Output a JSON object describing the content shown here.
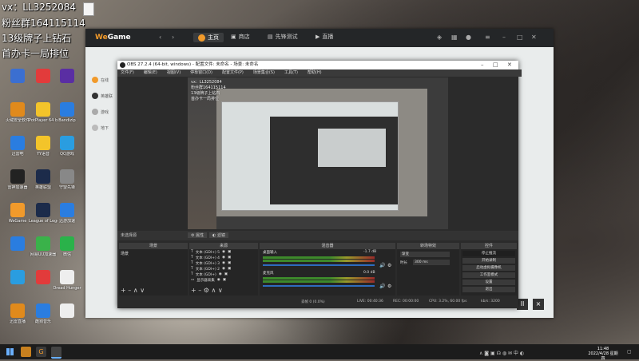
{
  "overlay": {
    "line1": "vx：LL3252084",
    "line2": "粉丝群164115114",
    "line3": "13级牌子上钻石",
    "line4": "首办卡一局排位"
  },
  "desktop_icons": [
    {
      "label": "",
      "color": "#3b6fd1"
    },
    {
      "label": "",
      "color": "#e23b3b"
    },
    {
      "label": "",
      "color": "#5a2ea3"
    },
    {
      "label": "火绒安全软件",
      "color": "#e08a1c"
    },
    {
      "label": "PotPlayer 64 bit",
      "color": "#f3c42a"
    },
    {
      "label": "Bandizip",
      "color": "#2a7de0"
    },
    {
      "label": "迅雷吧",
      "color": "#2a7de0"
    },
    {
      "label": "YY语音",
      "color": "#f3c42a"
    },
    {
      "label": "QQ游戏",
      "color": "#2a9de0"
    },
    {
      "label": "雷神加速器",
      "color": "#222"
    },
    {
      "label": "英雄联盟",
      "color": "#1c2b4a"
    },
    {
      "label": "守望先锋",
      "color": "#888"
    },
    {
      "label": "WeGame",
      "color": "#f19a2b"
    },
    {
      "label": "League of Legends",
      "color": "#1c2b4a"
    },
    {
      "label": "迅游加速",
      "color": "#2a7de0"
    },
    {
      "label": "",
      "color": "#2a7de0"
    },
    {
      "label": "网易UU加速器",
      "color": "#3ab24a"
    },
    {
      "label": "微信",
      "color": "#2ab24a"
    },
    {
      "label": "",
      "color": "#2a9de0"
    },
    {
      "label": "",
      "color": "#e23b3b"
    },
    {
      "label": "Dread Hunger",
      "color": "#eee"
    },
    {
      "label": "迅雷直播",
      "color": "#e08a1c"
    },
    {
      "label": "酷狗音乐",
      "color": "#2a7de0"
    },
    {
      "label": "",
      "color": "#eee"
    }
  ],
  "wegame": {
    "logo_we": "We",
    "logo_game": "Game",
    "nav": [
      {
        "label": "主页",
        "icon": "home-icon"
      },
      {
        "label": "商店",
        "icon": "store-icon"
      },
      {
        "label": "先锋测试",
        "icon": "test-icon"
      },
      {
        "label": "直播",
        "icon": "live-icon"
      }
    ],
    "side": [
      "在线",
      "英雄联",
      "游戏",
      "地下"
    ],
    "bottom": [
      "II",
      "×"
    ]
  },
  "obs": {
    "title": "OBS 27.2.4 (64-bit, windows) - 配置文件: 未命名 - 场景: 未命名",
    "menu": [
      "文件(F)",
      "编辑(E)",
      "视图(V)",
      "停靠窗口(D)",
      "配置文件(P)",
      "场景集合(S)",
      "工具(T)",
      "帮助(H)"
    ],
    "preview_overlay": [
      "vx：LL3252084",
      "粉丝群164115114",
      "13级牌子上钻石",
      "首办卡一局排位"
    ],
    "no_source": "未选择源",
    "props_btn": "属性",
    "filters_btn": "滤镜",
    "docks": {
      "scenes": "场景",
      "sources": "来源",
      "mixer": "混音器",
      "transitions": "转场特效",
      "controls": "控件"
    },
    "scene_item": "场景",
    "sources": [
      "文本 (GDI+) 5",
      "文本 (GDI+) 4",
      "文本 (GDI+) 3",
      "文本 (GDI+) 2",
      "文本 (GDI+)",
      "显示器采集"
    ],
    "mixer": [
      {
        "name": "桌面输入",
        "db": "-1.7 dB"
      },
      {
        "name": "麦克风",
        "db": "0.0 dB"
      }
    ],
    "transition": {
      "type": "渐变",
      "duration_label": "时长",
      "duration": "300 ms"
    },
    "controls": [
      "停止推流",
      "开始录制",
      "启动虚拟摄像机",
      "工作室模式",
      "设置",
      "退出"
    ],
    "status": {
      "dropped": "丢帧 0 (0.0%)",
      "live": "LIVE: 00:40:36",
      "rec": "REC: 00:00:00",
      "cpu": "CPU: 3.2%, 60.00 fps",
      "kbps": "kb/s: 3200"
    }
  },
  "taskbar": {
    "time": "11:48",
    "date": "2022/4/28 星期四"
  }
}
